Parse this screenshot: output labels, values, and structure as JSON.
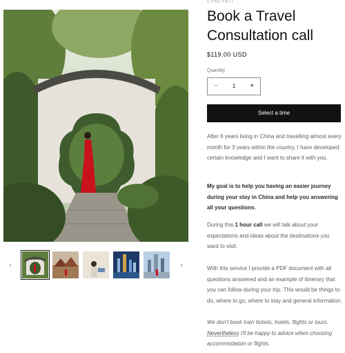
{
  "product": {
    "vendor": "CYNCYNTI",
    "title": "Book a Travel Consultation call",
    "price": "$119.00 USD",
    "quantity": {
      "label": "Quantity",
      "value": "1",
      "minus": "−",
      "plus": "+"
    },
    "cta_label": "Select a time"
  },
  "gallery": {
    "prev_arrow": "‹",
    "next_arrow": "›",
    "thumbnail_count": 5,
    "active_index": 0
  },
  "description": {
    "p1": "After 6 years living in China and travelling almost every month for 3 years within the country, I have developed certain knowledge and I want to share it with you.",
    "p2": "My goal is to help you having an easier journey during your stay in China and help you answering all your questions.",
    "p3_before": "During this ",
    "p3_bold": "1 hour call",
    "p3_after": " we will talk about your expectations and ideas about the destinations you want to visit.",
    "p4": "With this service I provide a PDF document with all questions answered and an example of itinerary that you can follow during your trip. This would be things to do, where to go, where to stay and general information.",
    "p5_before": "We don't book train tickets, hotels, flights or tours. ",
    "p5_underlined": "Nevertheless",
    "p5_after": " I'll be happy to advice when choosing accommodation or flights."
  },
  "colors": {
    "button_bg": "#121212",
    "button_text": "#ffffff",
    "body_text": "#5e5e5e",
    "dress_red": "#c8121c"
  }
}
